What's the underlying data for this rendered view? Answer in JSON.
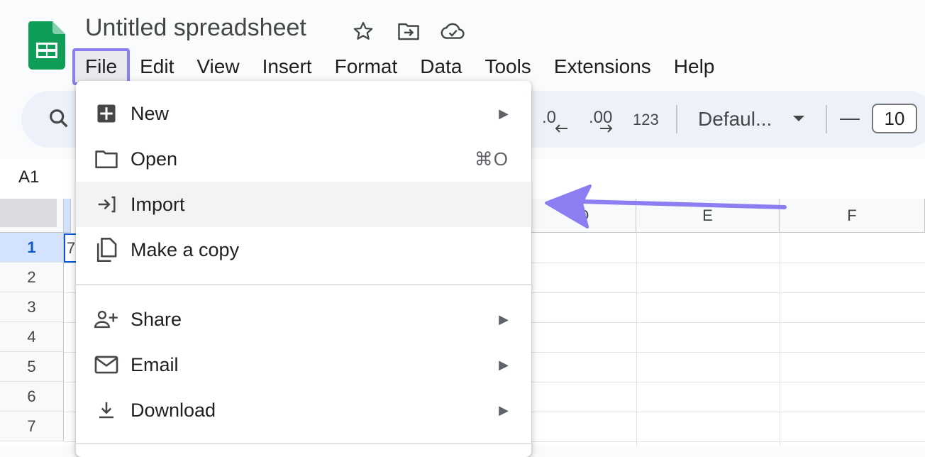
{
  "app": {
    "title": "Untitled spreadsheet",
    "icons": [
      "star-icon",
      "move-folder-icon",
      "cloud-saved-icon"
    ],
    "brand_color": "#0f9d58"
  },
  "menubar": {
    "items": [
      "File",
      "Edit",
      "View",
      "Insert",
      "Format",
      "Data",
      "Tools",
      "Extensions",
      "Help"
    ],
    "active": "File"
  },
  "toolbar": {
    "decrease_decimal": ".0",
    "increase_decimal": ".00",
    "number_format": "123",
    "font": "Defaul...",
    "font_size_minus": "—",
    "font_size": "10"
  },
  "name_box": "A1",
  "grid": {
    "columns": [
      "D",
      "E",
      "F"
    ],
    "rows": [
      "1",
      "2",
      "3",
      "4",
      "5",
      "6",
      "7"
    ],
    "selected_row": "1",
    "cell_a1_partial": "7"
  },
  "file_menu": {
    "items": [
      {
        "label": "New",
        "icon": "new-spreadsheet-icon",
        "submenu": true
      },
      {
        "label": "Open",
        "icon": "folder-icon",
        "shortcut": "⌘O"
      },
      {
        "label": "Import",
        "icon": "import-icon",
        "highlighted": true
      },
      {
        "label": "Make a copy",
        "icon": "copy-icon"
      },
      {
        "label": "Share",
        "icon": "share-person-icon",
        "submenu": true
      },
      {
        "label": "Email",
        "icon": "email-icon",
        "submenu": true
      },
      {
        "label": "Download",
        "icon": "download-icon",
        "submenu": true
      }
    ],
    "arrow_glyph": "▶"
  },
  "annotation": {
    "arrow_color": "#8b7ef2",
    "points_to": "Import"
  }
}
